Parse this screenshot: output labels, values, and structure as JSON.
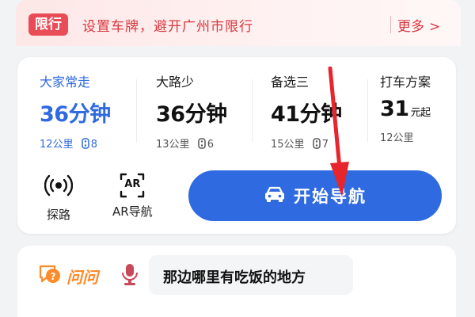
{
  "banner": {
    "badge": "限行",
    "text": "设置车牌，避开广州市限行",
    "more_label": "更多",
    "more_chevron": ">"
  },
  "routes": [
    {
      "name": "大家常走",
      "time": "36分钟",
      "distance": "12公里",
      "lights": "8",
      "active": true
    },
    {
      "name": "大路少",
      "time": "36分钟",
      "distance": "13公里",
      "lights": "6",
      "active": false
    },
    {
      "name": "备选三",
      "time": "41分钟",
      "distance": "15公里",
      "lights": "7",
      "active": false
    },
    {
      "name": "打车方案",
      "time": "31",
      "time_suffix": "元起",
      "distance": "12公里",
      "active": false
    }
  ],
  "actions": {
    "explore_label": "探路",
    "ar_icon_text": "AR",
    "ar_label": "AR导航",
    "start_nav_label": "开始导航"
  },
  "assistant": {
    "label": "问问",
    "query": "那边哪里有吃饭的地方"
  },
  "colors": {
    "accent": "#2f6ae0",
    "limit_red": "#e94c57",
    "arrow_red": "#e8242c",
    "ask_orange": "#ff8a2a"
  }
}
